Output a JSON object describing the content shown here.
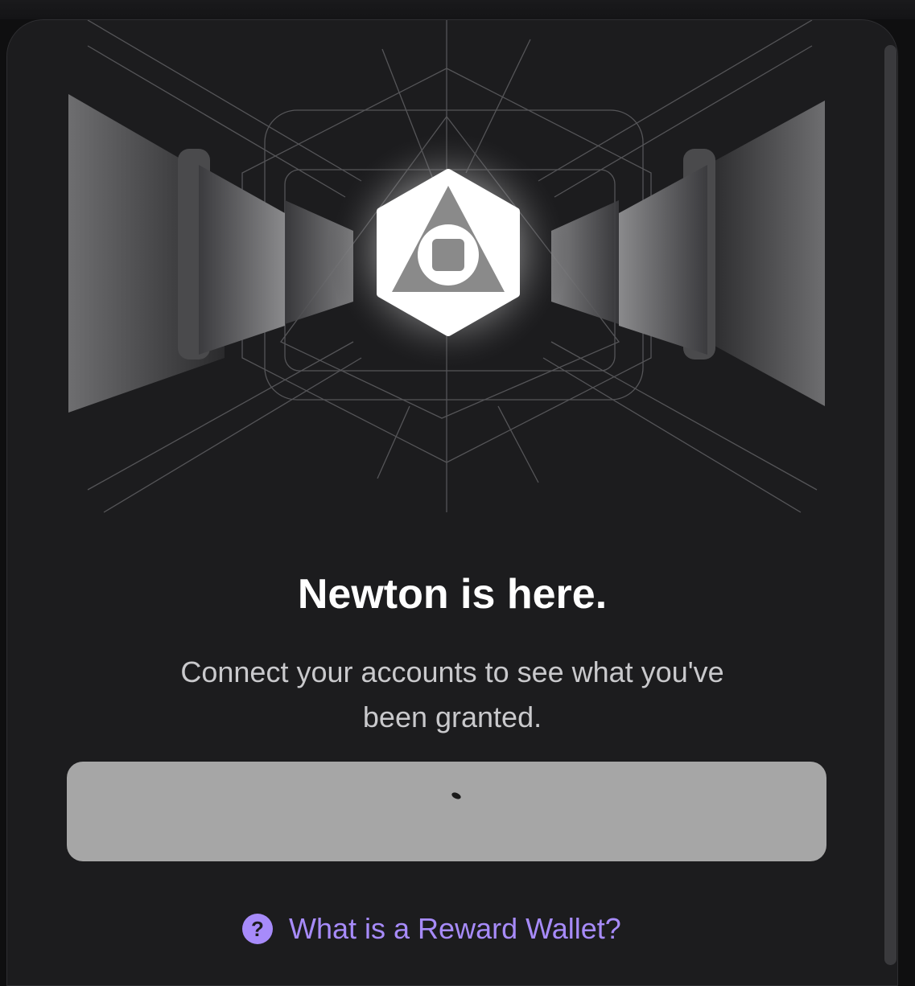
{
  "hero": {
    "icon": "newton-hexagon-triangle-logo"
  },
  "content": {
    "title": "Newton is here.",
    "subtitle": "Connect your accounts to see what you've been granted."
  },
  "connect_button": {
    "state": "loading",
    "icon": "spinner-icon"
  },
  "help_link": {
    "label": "What is a Reward Wallet?",
    "icon": "question-circle-icon",
    "icon_glyph": "?"
  },
  "colors": {
    "background": "#1c1c1e",
    "accent": "#a78bfa",
    "button": "#a6a6a6",
    "title": "#ffffff",
    "subtitle": "#c9c9cc"
  }
}
